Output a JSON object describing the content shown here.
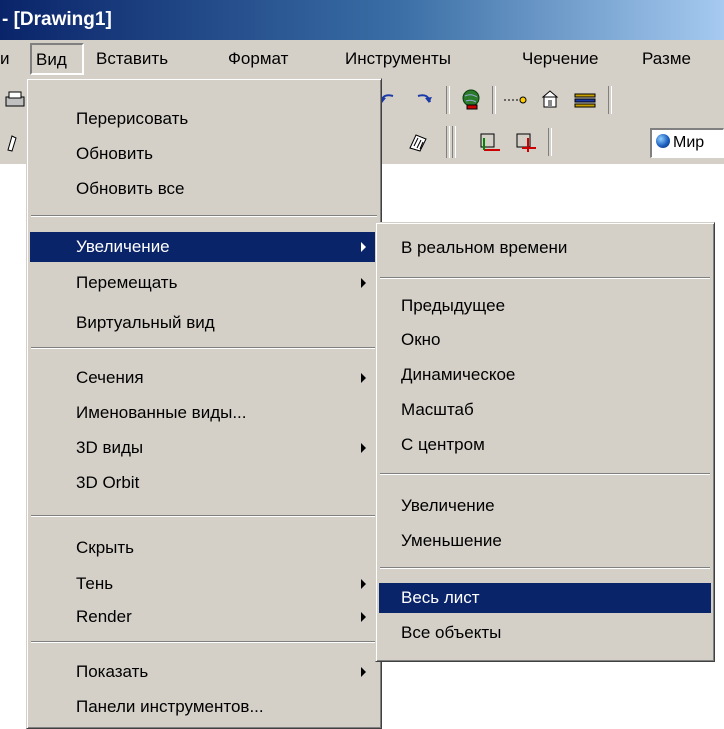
{
  "window": {
    "title": "- [Drawing1]"
  },
  "menubar": {
    "edge_item": "и",
    "items": [
      "Вид",
      "Вставить",
      "Формат",
      "Инструменты",
      "Черчение",
      "Разме"
    ]
  },
  "toolbar": {
    "world_label": "Мир",
    "icons": [
      "undo-icon",
      "redo-icon",
      "globe-link-icon",
      "distance-icon",
      "block-icon",
      "layer-icon",
      "hatch-icon",
      "ucs-icon",
      "ucs-named-icon"
    ]
  },
  "view_menu": {
    "items": [
      {
        "label": "Перерисовать",
        "submenu": false
      },
      {
        "label": "Обновить",
        "submenu": false
      },
      {
        "label": "Обновить все",
        "submenu": false
      },
      {
        "label": "Увеличение",
        "submenu": true,
        "selected": true
      },
      {
        "label": "Перемещать",
        "submenu": true
      },
      {
        "label": "Виртуальный вид",
        "submenu": false
      },
      {
        "label": "Сечения",
        "submenu": true
      },
      {
        "label": "Именованные виды...",
        "submenu": false
      },
      {
        "label": "3D виды",
        "submenu": true
      },
      {
        "label": "3D Orbit",
        "submenu": false
      },
      {
        "label": "Скрыть",
        "submenu": false
      },
      {
        "label": "Тень",
        "submenu": true
      },
      {
        "label": "Render",
        "submenu": true
      },
      {
        "label": "Показать",
        "submenu": true
      },
      {
        "label": "Панели инструментов...",
        "submenu": false
      }
    ]
  },
  "zoom_submenu": {
    "items": [
      {
        "label": "В реальном времени"
      },
      {
        "label": "Предыдущее"
      },
      {
        "label": "Окно"
      },
      {
        "label": "Динамическое"
      },
      {
        "label": "Масштаб"
      },
      {
        "label": "С центром"
      },
      {
        "label": "Увеличение"
      },
      {
        "label": "Уменьшение"
      },
      {
        "label": "Весь лист",
        "selected": true
      },
      {
        "label": "Все объекты"
      }
    ]
  }
}
